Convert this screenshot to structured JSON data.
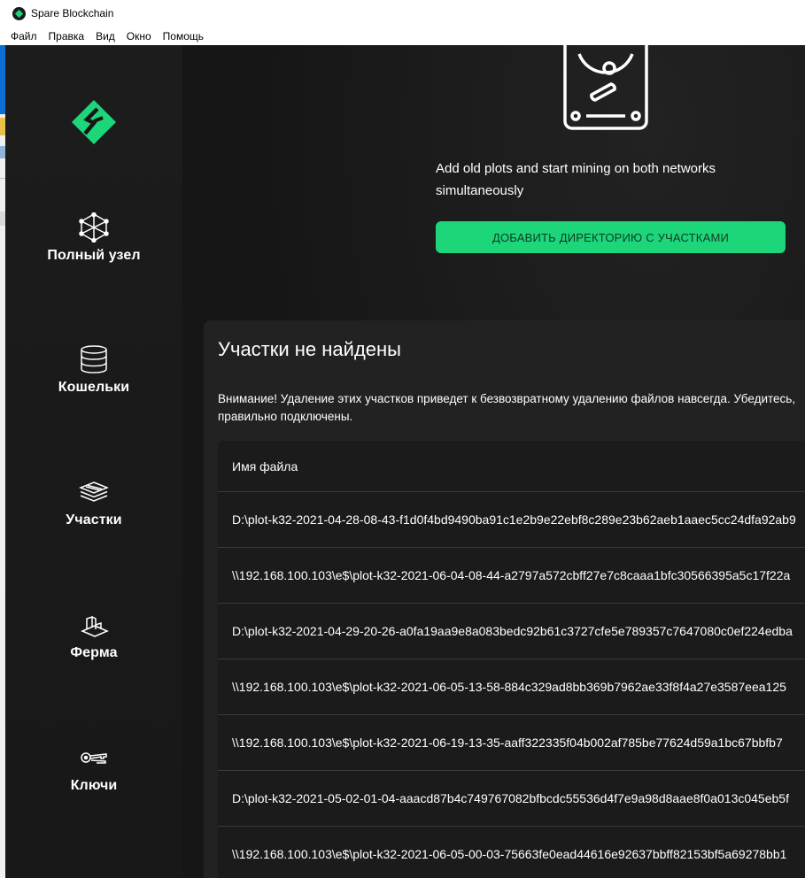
{
  "window": {
    "title": "Spare Blockchain",
    "menu": [
      "Файл",
      "Правка",
      "Вид",
      "Окно",
      "Помощь"
    ]
  },
  "sidebar": {
    "items": [
      {
        "label": "Полный узел",
        "icon": "network-node-icon"
      },
      {
        "label": "Кошельки",
        "icon": "wallet-coins-icon"
      },
      {
        "label": "Участки",
        "icon": "plots-layers-icon"
      },
      {
        "label": "Ферма",
        "icon": "farm-tractor-icon"
      },
      {
        "label": "Ключи",
        "icon": "keys-icon"
      }
    ]
  },
  "hero": {
    "text": "Add old plots and start mining on both networks simultaneously",
    "button_label": "ДОБАВИТЬ ДИРЕКТОРИЮ С УЧАСТКАМИ"
  },
  "plots_card": {
    "title": "Участки не найдены",
    "warning_line1": "Внимание! Удаление этих участков приведет к безвозвратному удалению файлов навсегда. Убедитесь,",
    "warning_line2": "правильно подключены.",
    "column_header": "Имя файла",
    "rows": [
      "D:\\plot-k32-2021-04-28-08-43-f1d0f4bd9490ba91c1e2b9e22ebf8c289e23b62aeb1aaec5cc24dfa92ab9",
      "\\\\192.168.100.103\\e$\\plot-k32-2021-06-04-08-44-a2797a572cbff27e7c8caaa1bfc30566395a5c17f22a",
      "D:\\plot-k32-2021-04-29-20-26-a0fa19aa9e8a083bedc92b61c3727cfe5e789357c7647080c0ef224edba",
      "\\\\192.168.100.103\\e$\\plot-k32-2021-06-05-13-58-884c329ad8bb369b7962ae33f8f4a27e3587eea125",
      "\\\\192.168.100.103\\e$\\plot-k32-2021-06-19-13-35-aaff322335f04b002af785be77624d59a1bc67bbfb7",
      "D:\\plot-k32-2021-05-02-01-04-aaacd87b4c749767082bfbcdc55536d4f7e9a98d8aae8f0a013c045eb5f",
      "\\\\192.168.100.103\\e$\\plot-k32-2021-06-05-00-03-75663fe0ead44616e92637bbff82153bf5a69278bb1"
    ]
  },
  "colors": {
    "accent": "#1ed67a",
    "background": "#161616",
    "card": "#222222"
  }
}
